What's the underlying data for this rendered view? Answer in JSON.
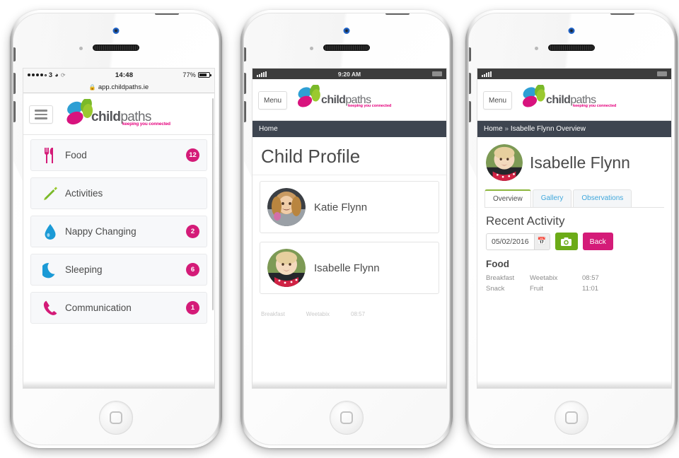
{
  "colors": {
    "brand_pink": "#d41b78",
    "brand_magenta": "#e5007d",
    "brand_green": "#6cab18",
    "brand_blue": "#0f9bd7",
    "tab_green": "#8cb63c",
    "link_blue": "#3fa7dc",
    "crumb_bg": "#3e4550"
  },
  "logo": {
    "word_a": "child",
    "word_b": "paths",
    "tagline": "keeping you connected"
  },
  "phone1": {
    "status": {
      "carrier": "3",
      "wifi_icon": "wifi-icon",
      "sync_icon": "sync-icon",
      "time": "14:48",
      "battery_percent": "77%",
      "battery_icon": "battery-icon"
    },
    "url_bar": {
      "lock_icon": "lock-icon",
      "url": "app.childpaths.ie"
    },
    "header": {
      "menu_icon": "hamburger-icon"
    },
    "menu_items": [
      {
        "label": "Food",
        "icon": "cutlery-icon",
        "badge": "12"
      },
      {
        "label": "Activities",
        "icon": "pencil-icon",
        "badge": ""
      },
      {
        "label": "Nappy Changing",
        "icon": "droplet-icon",
        "badge": "2"
      },
      {
        "label": "Sleeping",
        "icon": "moon-icon",
        "badge": "6"
      },
      {
        "label": "Communication",
        "icon": "phone-icon",
        "badge": "1"
      }
    ]
  },
  "phone2": {
    "status": {
      "signal_icon": "signal-bars-icon",
      "time": "9:20 AM",
      "battery_icon": "battery-icon"
    },
    "header": {
      "menu_label": "Menu"
    },
    "breadcrumb": "Home",
    "page_title": "Child Profile",
    "children": [
      {
        "name": "Katie Flynn",
        "avatar": "child-photo-katie"
      },
      {
        "name": "Isabelle Flynn",
        "avatar": "child-photo-isabelle"
      }
    ],
    "clipped_row": {
      "c1": "Breakfast",
      "c2": "Weetabix",
      "c3": "08:57"
    }
  },
  "phone3": {
    "status": {
      "signal_icon": "signal-bars-icon",
      "time": "",
      "battery_icon": "battery-icon"
    },
    "header": {
      "menu_label": "Menu"
    },
    "breadcrumb": {
      "home": "Home",
      "sep": "»",
      "current": "Isabelle Flynn Overview"
    },
    "profile": {
      "name": "Isabelle Flynn",
      "avatar": "child-photo-isabelle"
    },
    "tabs": [
      {
        "label": "Overview",
        "active": true
      },
      {
        "label": "Gallery",
        "active": false
      },
      {
        "label": "Observations",
        "active": false
      }
    ],
    "section_title": "Recent Activity",
    "controls": {
      "date_value": "05/02/2016",
      "calendar_icon": "calendar-icon",
      "camera_icon": "camera-icon",
      "back_label": "Back"
    },
    "food": {
      "title": "Food",
      "rows": [
        {
          "meal": "Breakfast",
          "item": "Weetabix",
          "time": "08:57"
        },
        {
          "meal": "Snack",
          "item": "Fruit",
          "time": "11:01"
        }
      ]
    }
  }
}
